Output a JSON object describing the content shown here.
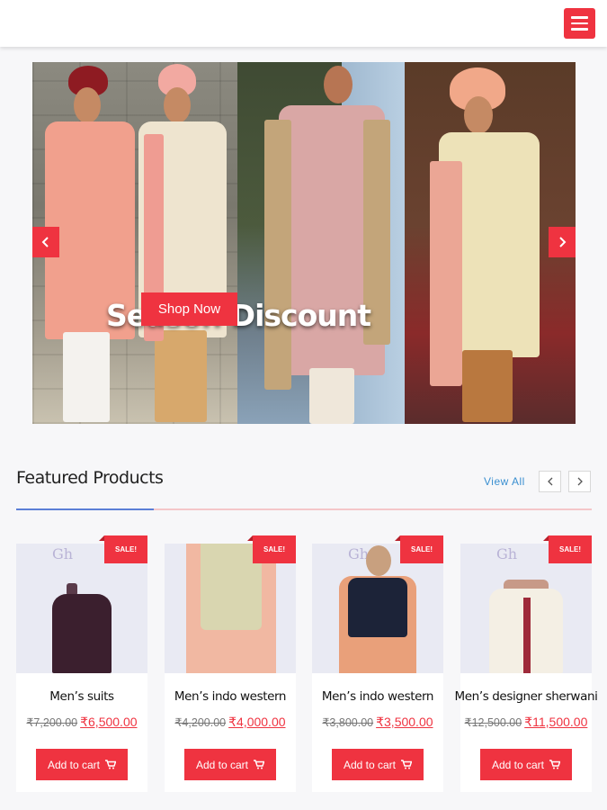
{
  "header": {
    "menu_icon": "hamburger-icon",
    "accent": "#ef3340"
  },
  "hero": {
    "caption": "Season Discount",
    "cta_label": "Shop Now",
    "prev_icon": "chevron-left-icon",
    "next_icon": "chevron-right-icon"
  },
  "featured": {
    "title": "Featured Products",
    "view_all": "View All",
    "prev_icon": "chevron-left-icon",
    "next_icon": "chevron-right-icon",
    "products": [
      {
        "badge": "SALE!",
        "name": "Men’s suits",
        "old_price": "₹7,200.00",
        "new_price": "₹6,500.00",
        "cta": "Add to cart"
      },
      {
        "badge": "SALE!",
        "name": "Men’s indo western",
        "old_price": "₹4,200.00",
        "new_price": "₹4,000.00",
        "cta": "Add to cart"
      },
      {
        "badge": "SALE!",
        "name": "Men’s indo western",
        "old_price": "₹3,800.00",
        "new_price": "₹3,500.00",
        "cta": "Add to cart"
      },
      {
        "badge": "SALE!",
        "name": "Men’s designer sherwani",
        "old_price": "₹12,500.00",
        "new_price": "₹11,500.00",
        "cta": "Add to cart"
      }
    ]
  }
}
